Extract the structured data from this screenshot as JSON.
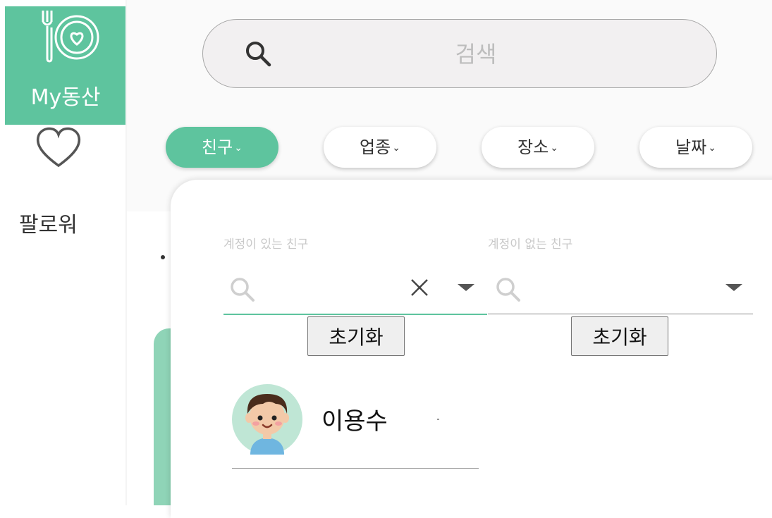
{
  "sidebar": {
    "items": [
      {
        "label": "My동산",
        "icon": "plate-heart-icon",
        "active": true
      },
      {
        "label": "팔로워",
        "icon": "heart-outline-icon",
        "active": false
      }
    ]
  },
  "search": {
    "placeholder": "검색",
    "value": "",
    "icon": "search-icon"
  },
  "filters": [
    {
      "label": "친구",
      "active": true
    },
    {
      "label": "업종",
      "active": false
    },
    {
      "label": "장소",
      "active": false
    },
    {
      "label": "날짜",
      "active": false
    }
  ],
  "friend_picker": {
    "with_account": {
      "label": "계정이 있는 친구",
      "value": "",
      "reset_label": "초기화"
    },
    "without_account": {
      "label": "계정이 없는 친구",
      "value": "",
      "reset_label": "초기화"
    },
    "friends": [
      {
        "name": "이용수",
        "avatar": "boy-avatar"
      }
    ]
  },
  "colors": {
    "accent": "#5ec49e",
    "accent_light": "#8fd4b7",
    "search_bg": "#f2f0f1"
  }
}
